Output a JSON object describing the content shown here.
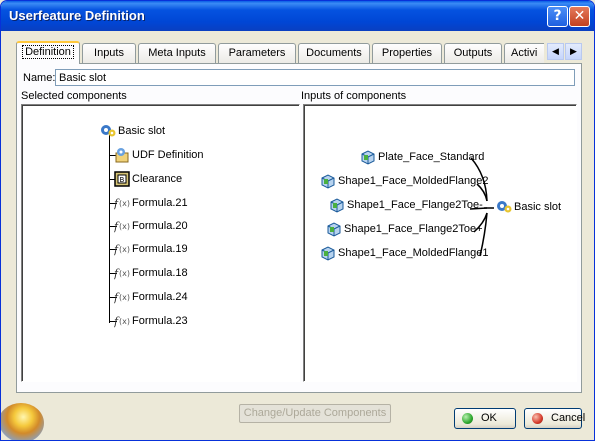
{
  "window": {
    "title": "Userfeature Definition",
    "help_label": "?",
    "close_label": "✕"
  },
  "tabs": [
    {
      "label": "Definition",
      "active": true
    },
    {
      "label": "Inputs"
    },
    {
      "label": "Meta Inputs"
    },
    {
      "label": "Parameters"
    },
    {
      "label": "Documents"
    },
    {
      "label": "Properties"
    },
    {
      "label": "Outputs"
    },
    {
      "label": "Activi"
    }
  ],
  "scroll": {
    "left": "◀",
    "right": "▶"
  },
  "name_field": {
    "label": "Name:",
    "value": "Basic slot"
  },
  "selected_components": {
    "label": "Selected components",
    "root": "Basic slot",
    "children": [
      "UDF Definition",
      "Clearance",
      "Formula.21",
      "Formula.20",
      "Formula.19",
      "Formula.18",
      "Formula.24",
      "Formula.23"
    ]
  },
  "inputs_of_components": {
    "label": "Inputs of components",
    "inputs": [
      "Plate_Face_Standard",
      "Shape1_Face_MoldedFlange2",
      "Shape1_Face_Flange2Toe-",
      "Shape1_Face_Flange2Toe+",
      "Shape1_Face_MoldedFlange1"
    ],
    "target": "Basic slot"
  },
  "change_button": "Change/Update Components",
  "ok_button": "OK",
  "cancel_button": "Cancel",
  "colors": {
    "titlebar": "#0553e0",
    "ok_dot": "#2fa82f",
    "cancel_dot": "#d53a2a",
    "active_tab_accent": "#ffc83c"
  }
}
